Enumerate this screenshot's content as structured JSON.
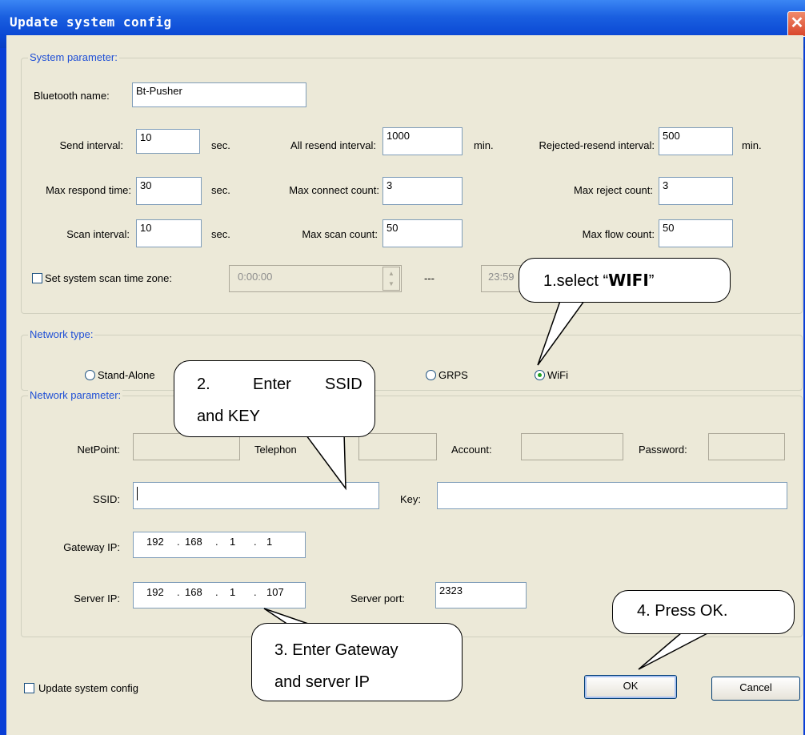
{
  "window": {
    "title": "Update system config",
    "close_glyph": "✕"
  },
  "system": {
    "group_label": "System parameter:",
    "bluetooth_name_label": "Bluetooth name:",
    "bluetooth_name_value": "Bt-Pusher",
    "send_interval_label": "Send interval:",
    "send_interval_value": "10",
    "send_interval_unit": "sec.",
    "all_resend_label": "All resend interval:",
    "all_resend_value": "1000",
    "all_resend_unit": "min.",
    "rejected_resend_label": "Rejected-resend interval:",
    "rejected_resend_value": "500",
    "rejected_resend_unit": "min.",
    "max_respond_label": "Max respond time:",
    "max_respond_value": "30",
    "max_respond_unit": "sec.",
    "max_connect_label": "Max connect count:",
    "max_connect_value": "3",
    "max_reject_label": "Max reject count:",
    "max_reject_value": "3",
    "scan_interval_label": "Scan interval:",
    "scan_interval_value": "10",
    "scan_interval_unit": "sec.",
    "max_scan_label": "Max scan count:",
    "max_scan_value": "50",
    "max_flow_label": "Max flow count:",
    "max_flow_value": "50",
    "scan_zone_label": "Set system scan time zone:",
    "scan_zone_checked": false,
    "scan_zone_start": "0:00:00",
    "scan_zone_dash": "---",
    "scan_zone_end": "23:59"
  },
  "network_type": {
    "group_label": "Network type:",
    "options": [
      {
        "label": "Stand-Alone",
        "selected": false
      },
      {
        "label": "GRPS",
        "selected": false
      },
      {
        "label": "WiFi",
        "selected": true
      }
    ]
  },
  "network": {
    "group_label": "Network parameter:",
    "netpoint_label": "NetPoint:",
    "telephone_label": "Telephon",
    "account_label": "Account:",
    "password_label": "Password:",
    "ssid_label": "SSID:",
    "ssid_value": "",
    "key_label": "Key:",
    "key_value": "",
    "gateway_label": "Gateway IP:",
    "gateway_ip": [
      "192",
      "168",
      "1",
      "1"
    ],
    "server_ip_label": "Server IP:",
    "server_ip": [
      "192",
      "168",
      "1",
      "107"
    ],
    "server_port_label": "Server port:",
    "server_port_value": "2323"
  },
  "footer": {
    "update_label": "Update system config",
    "update_checked": false,
    "ok_label": "OK",
    "cancel_label": "Cancel"
  },
  "callouts": {
    "c1_pre": "1.select “",
    "c1_bold": "WIFI",
    "c1_post": "”",
    "c2_line1_a": "2.",
    "c2_line1_b": "Enter",
    "c2_line1_c": "SSID",
    "c2_line2": "and KEY",
    "c3_line1": "3. Enter Gateway",
    "c3_line2": "and server IP",
    "c4": "4. Press OK."
  }
}
